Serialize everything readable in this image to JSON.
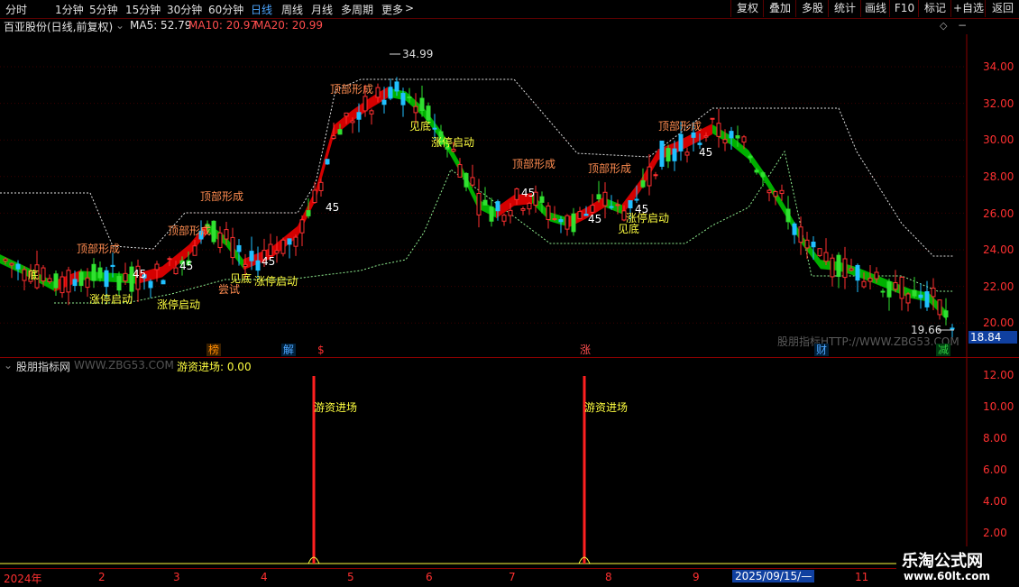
{
  "toolbar": {
    "periods": [
      "分时",
      "1分钟",
      "5分钟",
      "15分钟",
      "30分钟",
      "60分钟",
      "日线",
      "周线",
      "月线",
      "多周期",
      "更多"
    ],
    "active_period": "日线",
    "more_arrow": ">",
    "right_buttons": [
      "复权",
      "叠加",
      "多股",
      "统计",
      "画线",
      "F10",
      "标记",
      "+自选",
      "返回"
    ]
  },
  "title": {
    "stock_name": "百亚股份(日线,前复权)",
    "ma5": "MA5: 52.79",
    "ma10": "MA10: 20.97",
    "ma20": "MA20: 20.99"
  },
  "main_chart": {
    "y_ticks": [
      "34.00",
      "32.00",
      "30.00",
      "28.00",
      "26.00",
      "24.00",
      "22.00",
      "20.00"
    ],
    "current_price": "18.84",
    "high_label": "34.99",
    "low_label": "19.66",
    "watermark": "股朋指标HTTP://WWW.ZBG53.COM",
    "annotations": [
      "顶部形成",
      "顶部形成",
      "顶部形成",
      "顶部形成",
      "顶部形成",
      "顶部形成",
      "顶部形成",
      "涨停启动",
      "涨停启动",
      "涨停启动",
      "涨停启动",
      "涨停启动",
      "尝试",
      "见底",
      "见底",
      "见底",
      "底",
      "45",
      "45",
      "45",
      "45",
      "45",
      "45",
      "45",
      "45"
    ],
    "event_tags": [
      {
        "text": "榜",
        "color": "#ff8c00"
      },
      {
        "text": "解",
        "color": "#4da6ff"
      },
      {
        "text": "$",
        "color": "#ff3030"
      },
      {
        "text": "涨",
        "color": "#ff5050"
      },
      {
        "text": "财",
        "color": "#4da6ff"
      },
      {
        "text": "减",
        "color": "#2ecc40"
      }
    ]
  },
  "indicator": {
    "name": "股朋指标网",
    "url_text": "WWW.ZBG53.COM ·",
    "value_text": "游资进场: 0.00",
    "y_ticks": [
      "12.00",
      "10.00",
      "8.00",
      "6.00",
      "4.00",
      "2.00"
    ],
    "spike_label": "游资进场",
    "spike_value": 12.0
  },
  "x_axis": {
    "labels": [
      "2024年",
      "2",
      "3",
      "4",
      "5",
      "6",
      "7",
      "8",
      "9",
      "10",
      "11"
    ],
    "cursor_date": "2025/09/15/—"
  },
  "logo": {
    "title": "乐淘公式网",
    "url": "www.60lt.com"
  }
}
